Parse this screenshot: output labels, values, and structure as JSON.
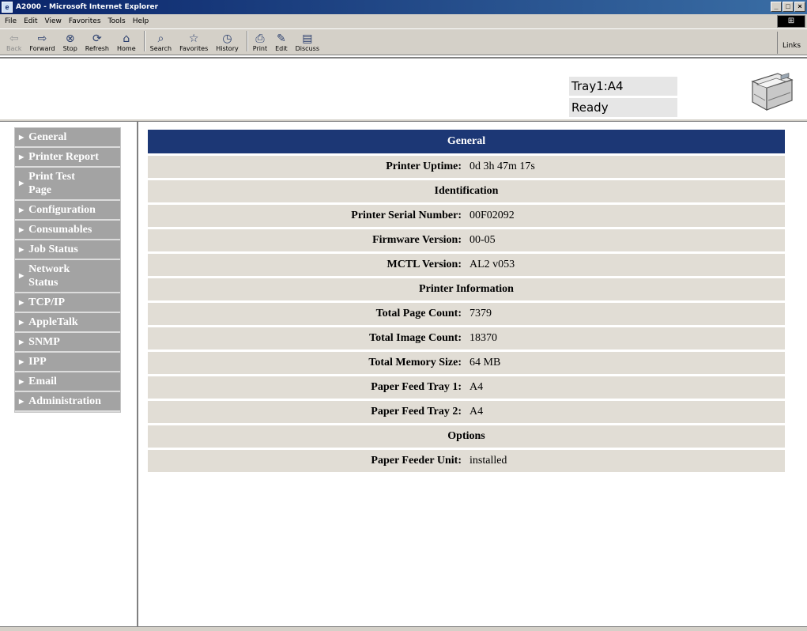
{
  "window": {
    "title": "A2000 - Microsoft Internet Explorer",
    "buttons": [
      "_",
      "□",
      "×"
    ]
  },
  "menubar": {
    "items": [
      "File",
      "Edit",
      "View",
      "Favorites",
      "Tools",
      "Help"
    ]
  },
  "toolbar": {
    "buttons": [
      {
        "label": "Back",
        "icon": "back-arrow-icon",
        "glyph": "⇦"
      },
      {
        "label": "Forward",
        "icon": "forward-arrow-icon",
        "glyph": "⇨"
      },
      {
        "label": "Stop",
        "icon": "stop-icon",
        "glyph": "⊗"
      },
      {
        "label": "Refresh",
        "icon": "refresh-icon",
        "glyph": "⟳"
      },
      {
        "label": "Home",
        "icon": "home-icon",
        "glyph": "⌂"
      },
      {
        "label": "Search",
        "icon": "search-icon",
        "glyph": "⌕"
      },
      {
        "label": "Favorites",
        "icon": "favorites-icon",
        "glyph": "☆"
      },
      {
        "label": "History",
        "icon": "history-icon",
        "glyph": "◷"
      },
      {
        "label": "Print",
        "icon": "print-icon",
        "glyph": "⎙"
      },
      {
        "label": "Edit",
        "icon": "edit-icon",
        "glyph": "✎"
      },
      {
        "label": "Discuss",
        "icon": "discuss-icon",
        "glyph": "▤"
      }
    ],
    "links_label": "Links"
  },
  "header": {
    "tray_status": "Tray1:A4",
    "printer_status": "Ready"
  },
  "sidebar": {
    "items": [
      {
        "label": "General"
      },
      {
        "label": "Printer Report"
      },
      {
        "label": "Print Test Page"
      },
      {
        "label": "Configuration"
      },
      {
        "label": "Consumables"
      },
      {
        "label": "Job Status"
      },
      {
        "label": "Network Status"
      },
      {
        "label": "TCP/IP"
      },
      {
        "label": "AppleTalk"
      },
      {
        "label": "SNMP"
      },
      {
        "label": "IPP"
      },
      {
        "label": "Email"
      },
      {
        "label": "Administration"
      }
    ]
  },
  "general": {
    "title": "General",
    "uptime": {
      "key": "Printer Uptime:",
      "value": "0d 3h 47m 17s"
    },
    "identification": {
      "heading": "Identification",
      "serial": {
        "key": "Printer Serial Number:",
        "value": "00F02092"
      },
      "firmware": {
        "key": "Firmware Version:",
        "value": "00-05"
      },
      "mctl": {
        "key": "MCTL Version:",
        "value": "AL2 v053"
      }
    },
    "printer_info": {
      "heading": "Printer Information",
      "page_count": {
        "key": "Total Page Count:",
        "value": "7379"
      },
      "image_count": {
        "key": "Total Image Count:",
        "value": "18370"
      },
      "memory": {
        "key": "Total Memory Size:",
        "value": "64 MB"
      },
      "tray1": {
        "key": "Paper Feed Tray 1:",
        "value": "A4"
      },
      "tray2": {
        "key": "Paper Feed Tray 2:",
        "value": "A4"
      }
    },
    "options": {
      "heading": "Options",
      "feeder": {
        "key": "Paper Feeder Unit:",
        "value": "installed"
      }
    }
  },
  "colors": {
    "header_bar": "#1c3775",
    "row_bg": "#e1ddd5",
    "sidebar_item": "#a3a3a3"
  }
}
